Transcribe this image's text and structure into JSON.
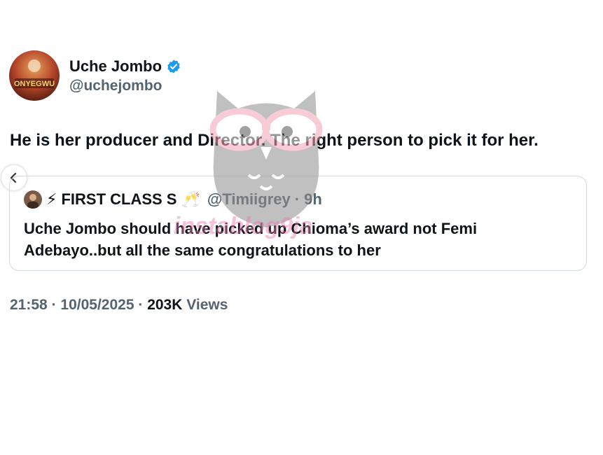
{
  "tweet": {
    "author": {
      "display_name": "Uche Jombo",
      "handle": "@uchejombo",
      "verified": true,
      "avatar_caption": "ONYEGWU"
    },
    "text": "He is her producer and Director. The right person to pick it for her.",
    "quote": {
      "author_emoji": "⚡",
      "author_name": "FIRST CLASS S",
      "author_name_emoji": "🥂",
      "handle": "@Timiigrey",
      "separator": "·",
      "time": "9h",
      "text": "Uche Jombo should have picked up Chioma’s award not Femi Adebayo..but all the same congratulations to her"
    },
    "meta": {
      "time": "21:58",
      "date": "10/05/2025",
      "separator": "·",
      "views_count": "203K",
      "views_label": "Views"
    }
  },
  "watermark": {
    "text": "instablog9ja"
  },
  "colors": {
    "text_primary": "#0f1419",
    "text_secondary": "#536471",
    "verified_blue": "#1d9bf0",
    "border": "#cfd9de"
  }
}
